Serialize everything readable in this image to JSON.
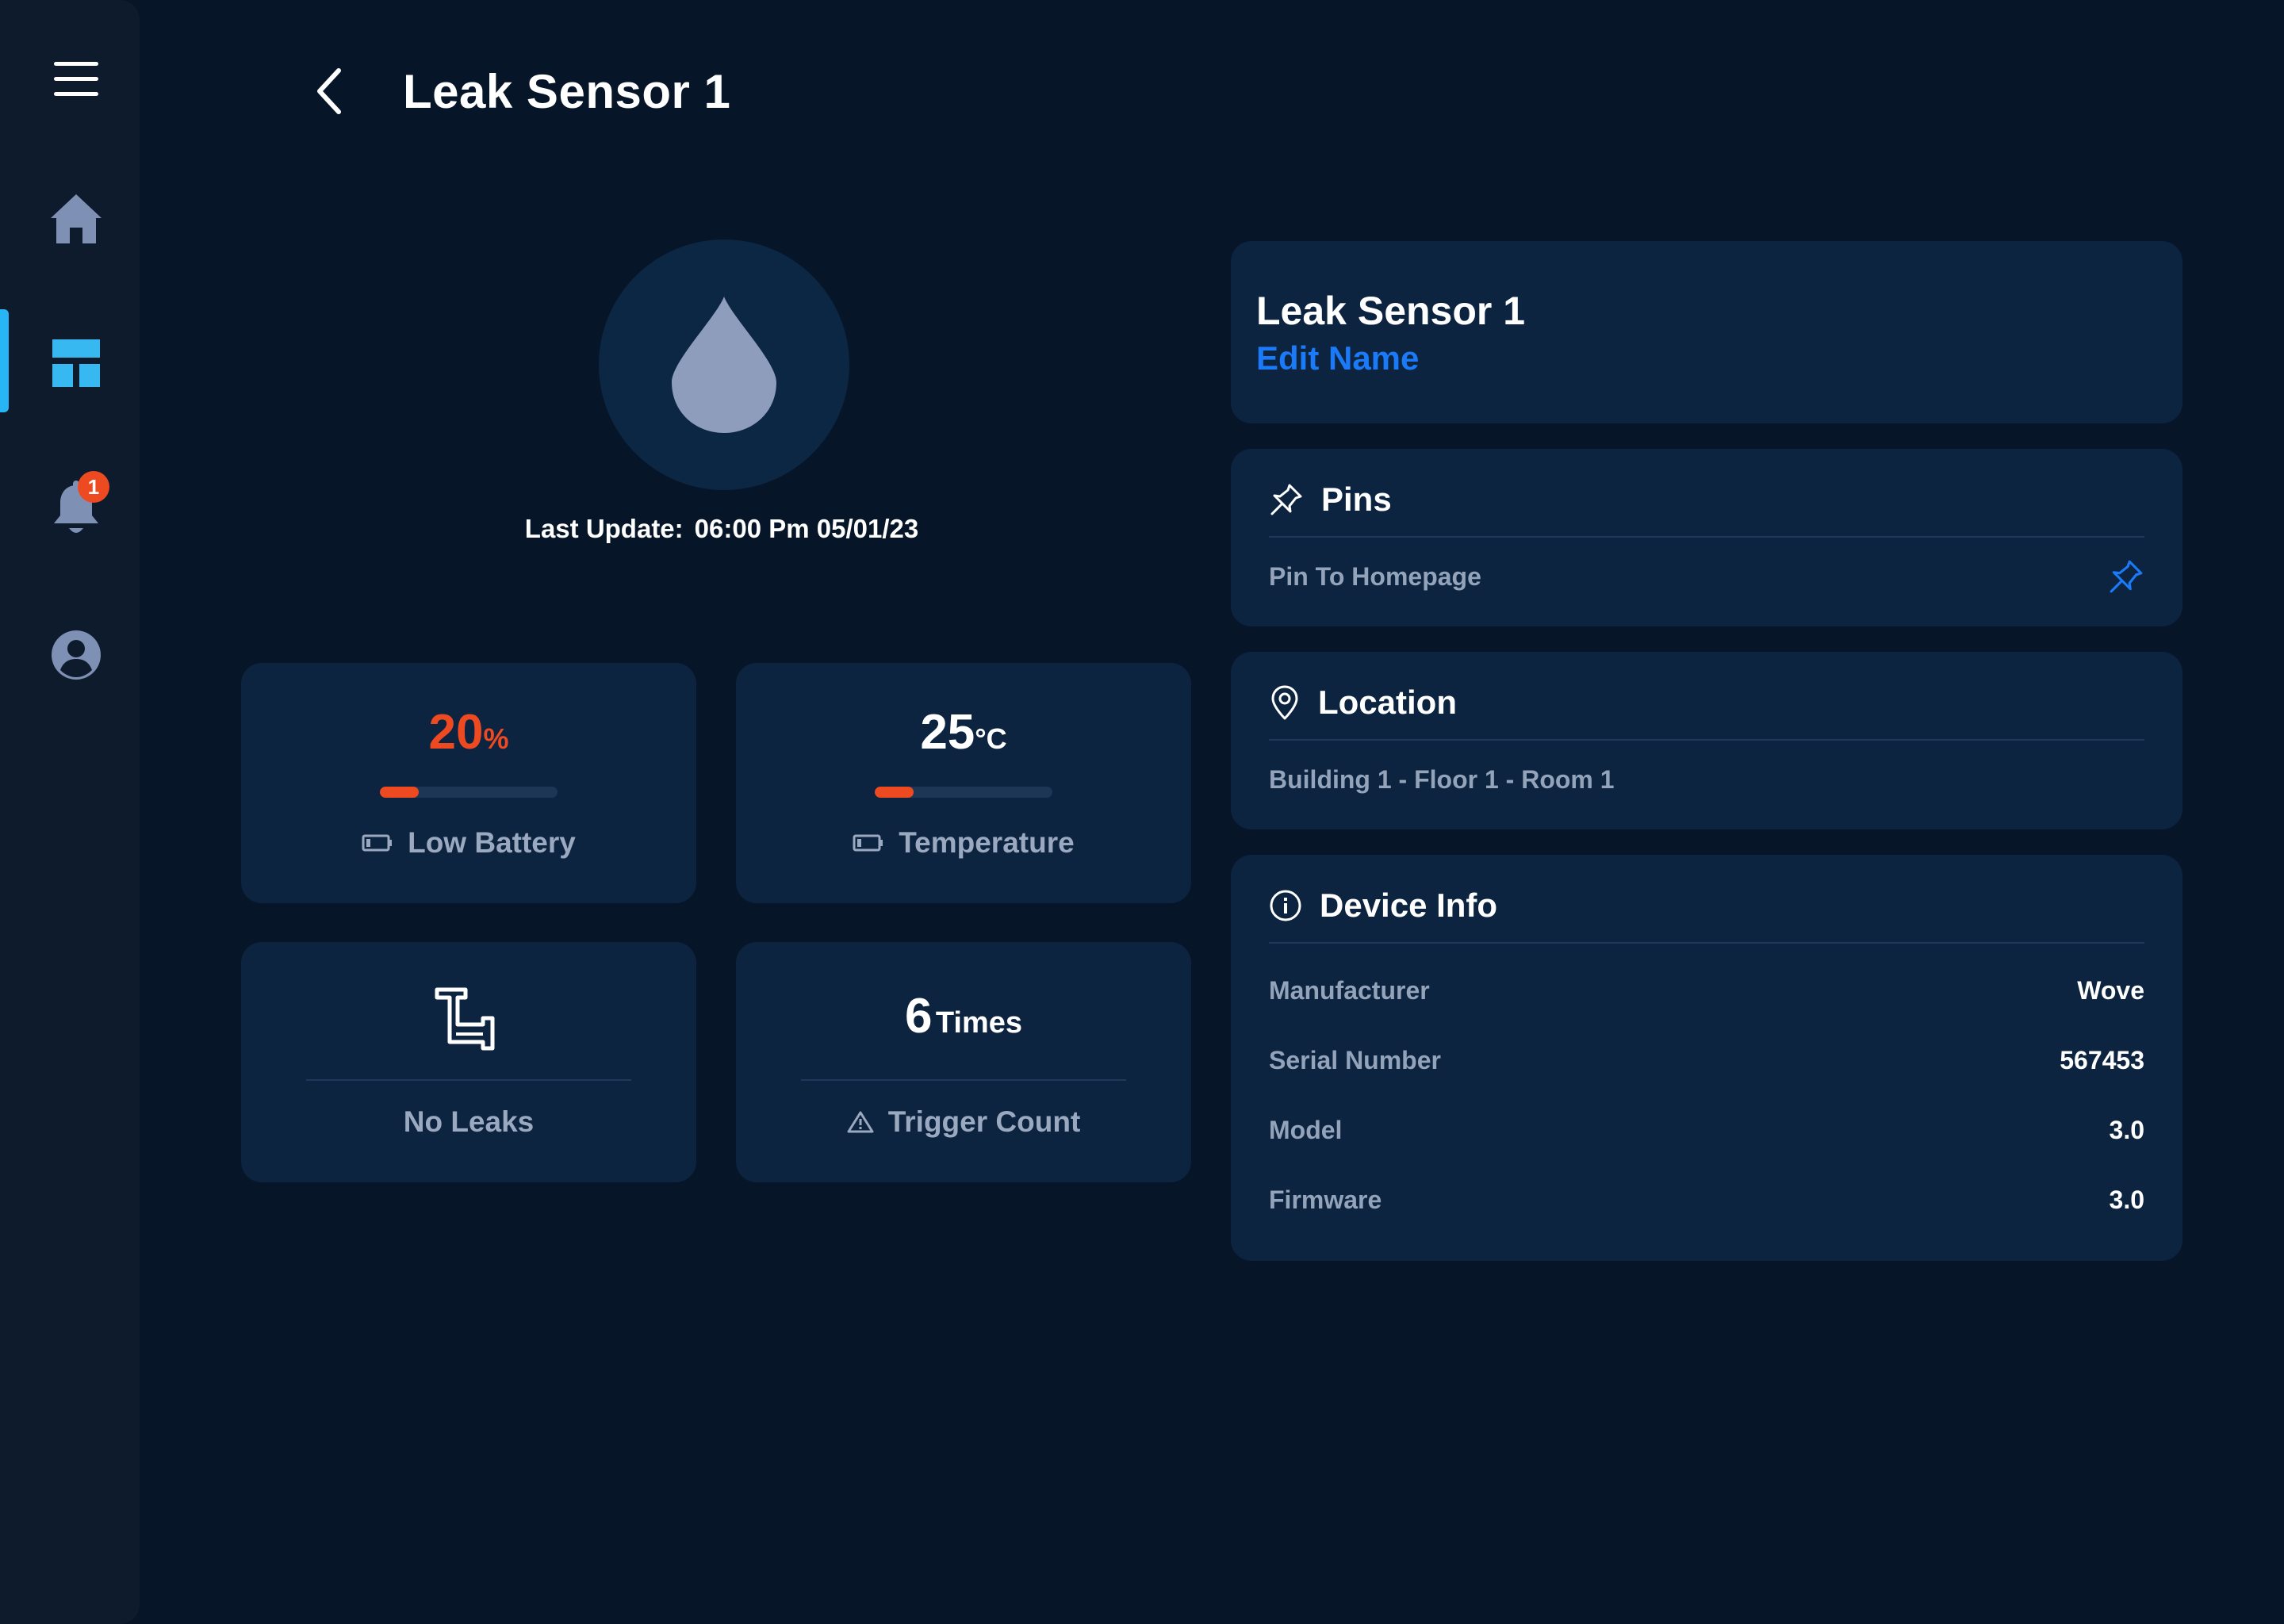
{
  "sidebar": {
    "notification_count": "1"
  },
  "header": {
    "title": "Leak Sensor 1"
  },
  "hero": {
    "last_update_label": "Last Update:",
    "last_update_value": "06:00 Pm 05/01/23"
  },
  "stats": {
    "battery": {
      "value": "20",
      "unit": "%",
      "label": "Low Battery",
      "level": 0.22
    },
    "temperature": {
      "value": "25",
      "unit": "°C",
      "label": "Temperature",
      "level": 0.22
    },
    "leaks": {
      "label": "No Leaks"
    },
    "triggers": {
      "value": "6",
      "unit": "Times",
      "label": "Trigger Count"
    }
  },
  "name_card": {
    "title": "Leak Sensor 1",
    "edit_label": "Edit Name"
  },
  "pins_card": {
    "title": "Pins",
    "pin_label": "Pin To Homepage"
  },
  "location_card": {
    "title": "Location",
    "value": "Building 1 - Floor 1 - Room 1"
  },
  "device_info": {
    "title": "Device Info",
    "rows": [
      {
        "label": "Manufacturer",
        "value": "Wove"
      },
      {
        "label": "Serial Number",
        "value": "567453"
      },
      {
        "label": "Model",
        "value": "3.0"
      },
      {
        "label": "Firmware",
        "value": "3.0"
      }
    ]
  },
  "colors": {
    "background": "#061527",
    "card": "#0c2440",
    "accent": "#27b5f5",
    "link": "#1a7af8",
    "alert": "#ee4a22"
  }
}
